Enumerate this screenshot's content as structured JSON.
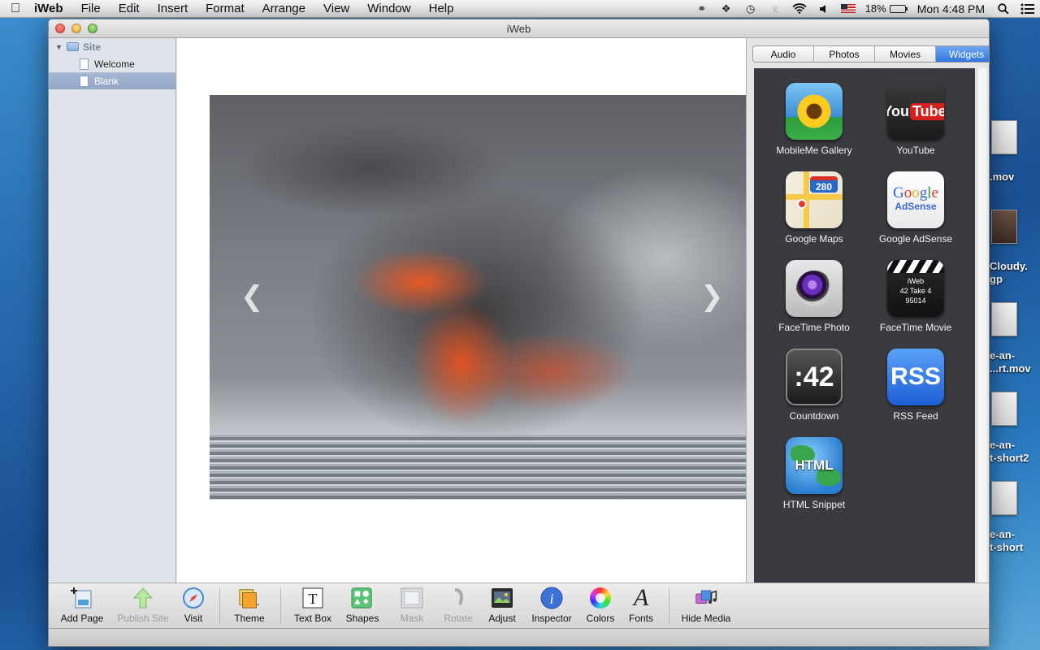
{
  "menubar": {
    "app_name": "iWeb",
    "items": [
      "File",
      "Edit",
      "Insert",
      "Format",
      "Arrange",
      "View",
      "Window",
      "Help"
    ],
    "battery": "18%",
    "clock": "Mon 4:48 PM"
  },
  "desktop": {
    "files": [
      ".mov",
      "Cloudy.",
      "gp",
      "e-an-",
      "...rt.mov",
      "e-an-",
      "t-short2",
      "e-an-",
      "t-short"
    ]
  },
  "window": {
    "title": "iWeb"
  },
  "sidebar": {
    "site_label": "Site",
    "pages": [
      "Welcome",
      "Blank"
    ],
    "selected_page": "Blank"
  },
  "media": {
    "tabs": [
      "Audio",
      "Photos",
      "Movies",
      "Widgets"
    ],
    "active_tab": "Widgets",
    "widgets": [
      {
        "label": "MobileMe Gallery",
        "icon": "mobileme-gallery-icon"
      },
      {
        "label": "YouTube",
        "icon": "youtube-icon"
      },
      {
        "label": "Google Maps",
        "icon": "google-maps-icon"
      },
      {
        "label": "Google AdSense",
        "icon": "google-adsense-icon"
      },
      {
        "label": "FaceTime Photo",
        "icon": "facetime-photo-icon"
      },
      {
        "label": "FaceTime Movie",
        "icon": "facetime-movie-icon"
      },
      {
        "label": "Countdown",
        "icon": "countdown-icon"
      },
      {
        "label": "RSS Feed",
        "icon": "rss-feed-icon"
      },
      {
        "label": "HTML Snippet",
        "icon": "html-snippet-icon"
      }
    ],
    "icon_text": {
      "youtube_you": "You",
      "youtube_tube": "Tube",
      "maps_shield": "280",
      "adsense_google": [
        "G",
        "o",
        "o",
        "g",
        "l",
        "e"
      ],
      "adsense_word": "AdSense",
      "movie_line1": "iWeb",
      "movie_line2": "42  Take 4",
      "movie_line3": "95014",
      "countdown": ":42",
      "rss": "RSS",
      "html": "HTML"
    }
  },
  "toolbar": {
    "add_page": "Add Page",
    "publish_site": "Publish Site",
    "visit": "Visit",
    "theme": "Theme",
    "text_box": "Text Box",
    "shapes": "Shapes",
    "mask": "Mask",
    "rotate": "Rotate",
    "adjust": "Adjust",
    "inspector": "Inspector",
    "colors": "Colors",
    "fonts": "Fonts",
    "hide_media": "Hide Media"
  }
}
